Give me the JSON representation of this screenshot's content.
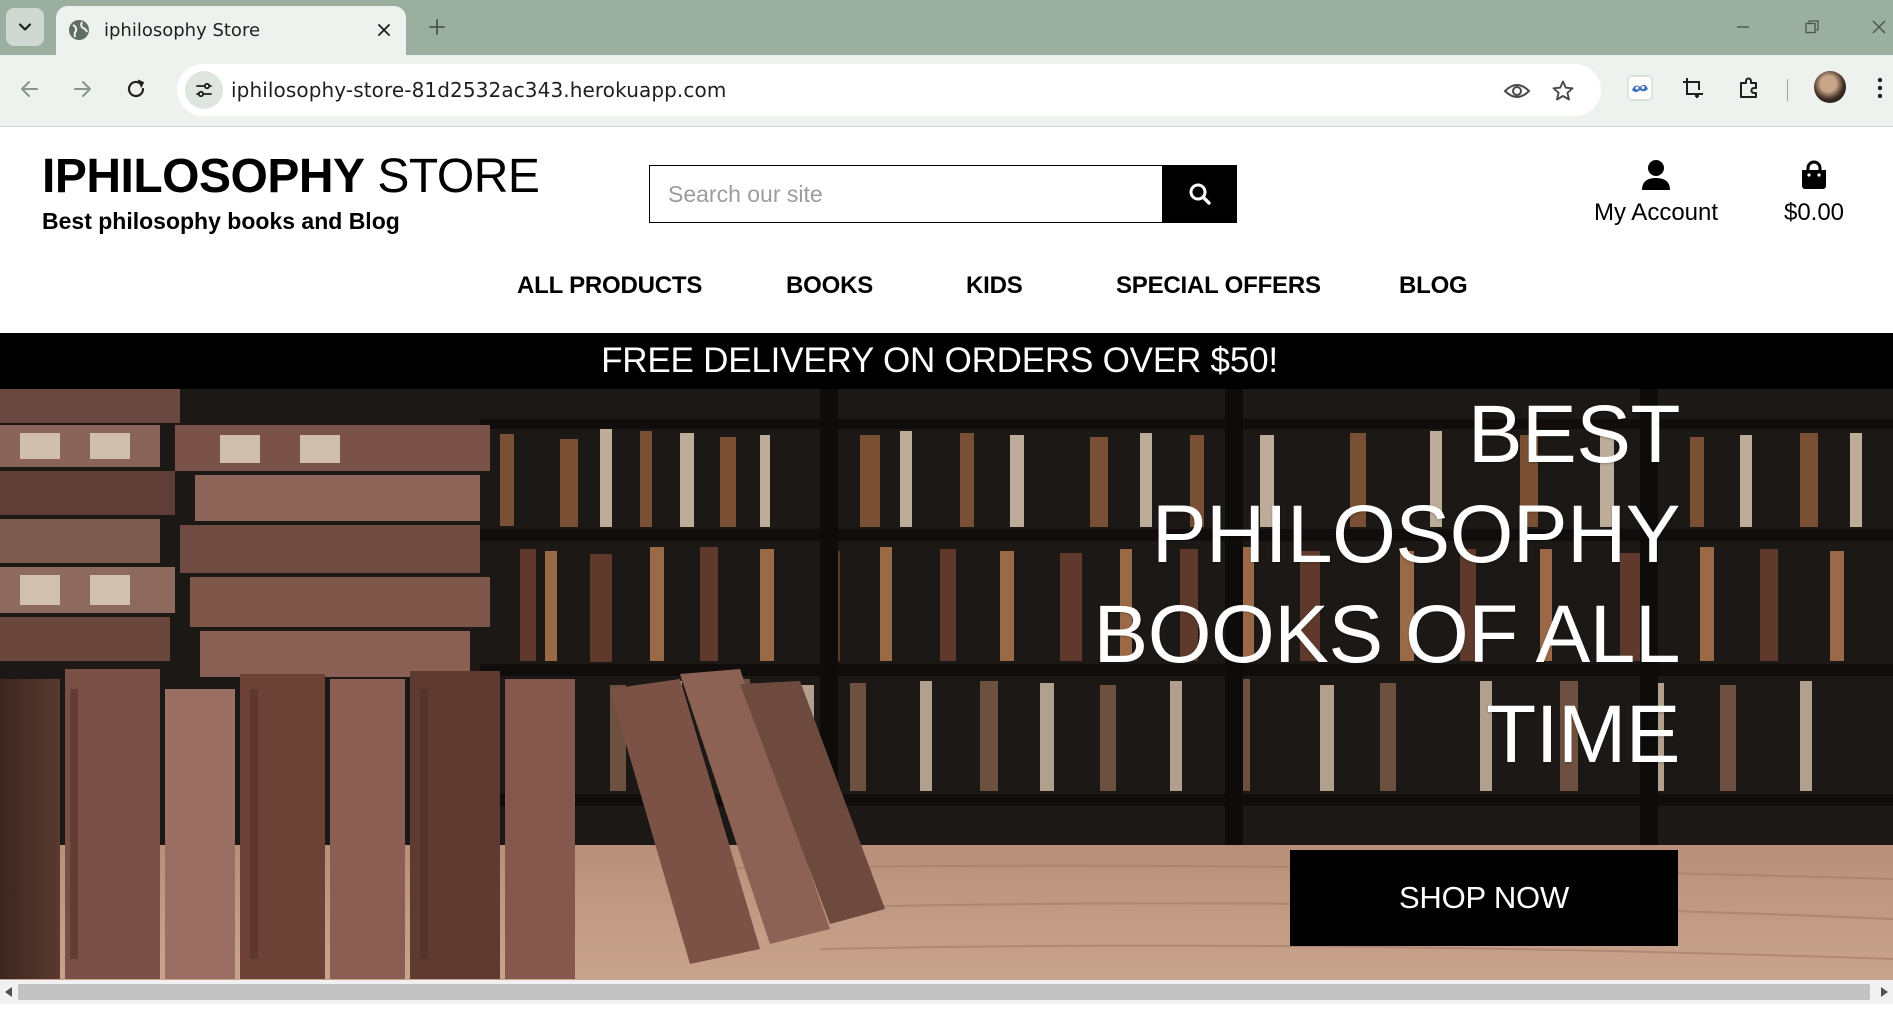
{
  "browser": {
    "tab_title": "iphilosophy Store",
    "url": "iphilosophy-store-81d2532ac343.herokuapp.com"
  },
  "site": {
    "brand_bold": "IPHILOSOPHY",
    "brand_light": "STORE",
    "tagline": "Best philosophy books and Blog",
    "search_placeholder": "Search our site",
    "account_label": "My Account",
    "cart_total": "$0.00",
    "nav": [
      "ALL PRODUCTS",
      "BOOKS",
      "KIDS",
      "SPECIAL OFFERS",
      "BLOG"
    ],
    "promo_text": "FREE DELIVERY ON ORDERS OVER $50!",
    "hero": {
      "headline": "BEST PHILOSOPHY BOOKS OF ALL TIME",
      "cta_label": "SHOP NOW"
    }
  },
  "colors": {
    "chrome_tabbar": "#9aaf9f",
    "chrome_toolbar": "#eef2ef",
    "brand_text": "#000000",
    "promo_bg": "#000000",
    "cta_bg": "#000000"
  },
  "icons": {
    "tab_menu": "chevron-down-icon",
    "favicon": "globe-icon",
    "tab_close": "close-icon",
    "new_tab": "plus-icon",
    "back": "arrow-left-icon",
    "forward": "arrow-right-icon",
    "reload": "reload-icon",
    "site_info": "tune-icon",
    "privacy": "eye-icon",
    "bookmark": "star-icon",
    "search": "search-icon",
    "account": "user-icon",
    "cart": "shopping-bag-icon"
  }
}
